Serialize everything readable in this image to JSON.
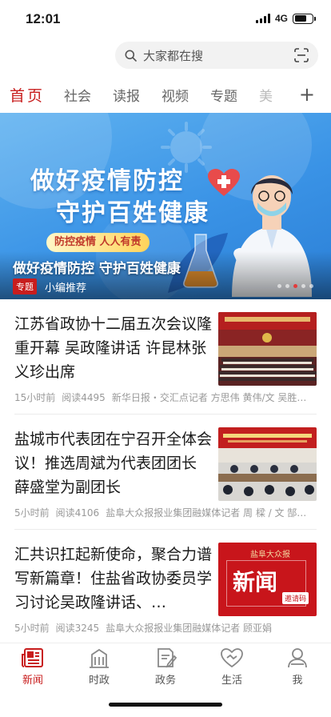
{
  "status": {
    "time": "12:01",
    "network": "4G"
  },
  "search": {
    "placeholder": "大家都在搜"
  },
  "tabs": [
    "首页",
    "社会",
    "读报",
    "视频",
    "专题",
    "美"
  ],
  "banner": {
    "headline_line1": "做好疫情防控",
    "headline_line2": "守护百姓健康",
    "slogan": "防控疫情  人人有责",
    "caption": "做好疫情防控 守护百姓健康",
    "tag": "专题",
    "recommend": "小编推荐",
    "dots_count": 5,
    "active_dot": 2
  },
  "news": [
    {
      "title": "江苏省政协十二届五次会议隆重开幕 吴政隆讲话 许昆林张义珍出席",
      "time": "15小时前",
      "reads": "阅读4495",
      "source": "新华日报・交汇点记者 方思伟 黄伟/文 吴胜…"
    },
    {
      "title": "盐城市代表团在宁召开全体会议！推选周斌为代表团团长 薛盛堂为副团长",
      "time": "5小时前",
      "reads": "阅读4106",
      "source": "盐阜大众报报业集团融媒体记者 周 樑 / 文 郜…"
    },
    {
      "title": "汇共识扛起新使命，聚合力谱写新篇章！住盐省政协委员学习讨论吴政隆讲话、…",
      "time": "5小时前",
      "reads": "阅读3245",
      "source": "盐阜大众报报业集团融媒体记者  顾亚娟",
      "thumb_brand": "盐阜大众报",
      "thumb_text": "新闻",
      "thumb_badge": "邀请码"
    }
  ],
  "bottom_nav": [
    {
      "label": "新闻",
      "icon": "newspaper-icon",
      "active": true
    },
    {
      "label": "时政",
      "icon": "building-icon",
      "active": false
    },
    {
      "label": "政务",
      "icon": "document-pen-icon",
      "active": false
    },
    {
      "label": "生活",
      "icon": "handshake-icon",
      "active": false
    },
    {
      "label": "我",
      "icon": "person-icon",
      "active": false
    }
  ],
  "colors": {
    "accent": "#c81d1d",
    "banner_blue": "#3a93e6",
    "meta_gray": "#999999"
  }
}
